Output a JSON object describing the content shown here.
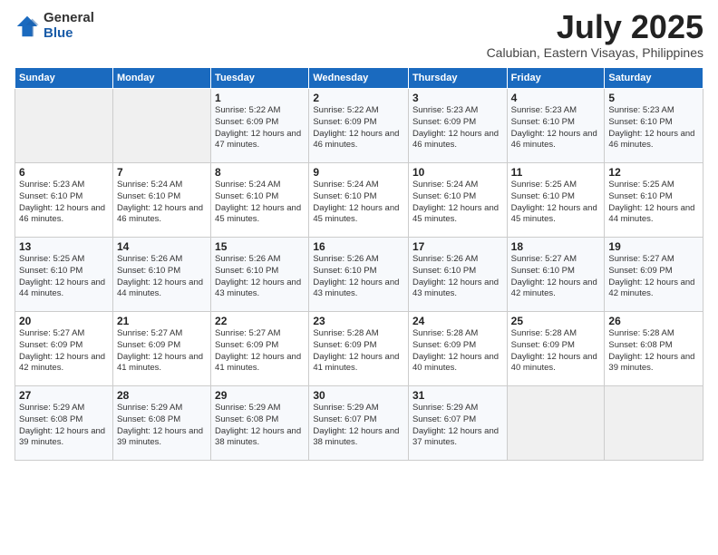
{
  "header": {
    "logo_line1": "General",
    "logo_line2": "Blue",
    "main_title": "July 2025",
    "subtitle": "Calubian, Eastern Visayas, Philippines"
  },
  "days_of_week": [
    "Sunday",
    "Monday",
    "Tuesday",
    "Wednesday",
    "Thursday",
    "Friday",
    "Saturday"
  ],
  "weeks": [
    [
      {
        "day": "",
        "info": ""
      },
      {
        "day": "",
        "info": ""
      },
      {
        "day": "1",
        "info": "Sunrise: 5:22 AM\nSunset: 6:09 PM\nDaylight: 12 hours and 47 minutes."
      },
      {
        "day": "2",
        "info": "Sunrise: 5:22 AM\nSunset: 6:09 PM\nDaylight: 12 hours and 46 minutes."
      },
      {
        "day": "3",
        "info": "Sunrise: 5:23 AM\nSunset: 6:09 PM\nDaylight: 12 hours and 46 minutes."
      },
      {
        "day": "4",
        "info": "Sunrise: 5:23 AM\nSunset: 6:10 PM\nDaylight: 12 hours and 46 minutes."
      },
      {
        "day": "5",
        "info": "Sunrise: 5:23 AM\nSunset: 6:10 PM\nDaylight: 12 hours and 46 minutes."
      }
    ],
    [
      {
        "day": "6",
        "info": "Sunrise: 5:23 AM\nSunset: 6:10 PM\nDaylight: 12 hours and 46 minutes."
      },
      {
        "day": "7",
        "info": "Sunrise: 5:24 AM\nSunset: 6:10 PM\nDaylight: 12 hours and 46 minutes."
      },
      {
        "day": "8",
        "info": "Sunrise: 5:24 AM\nSunset: 6:10 PM\nDaylight: 12 hours and 45 minutes."
      },
      {
        "day": "9",
        "info": "Sunrise: 5:24 AM\nSunset: 6:10 PM\nDaylight: 12 hours and 45 minutes."
      },
      {
        "day": "10",
        "info": "Sunrise: 5:24 AM\nSunset: 6:10 PM\nDaylight: 12 hours and 45 minutes."
      },
      {
        "day": "11",
        "info": "Sunrise: 5:25 AM\nSunset: 6:10 PM\nDaylight: 12 hours and 45 minutes."
      },
      {
        "day": "12",
        "info": "Sunrise: 5:25 AM\nSunset: 6:10 PM\nDaylight: 12 hours and 44 minutes."
      }
    ],
    [
      {
        "day": "13",
        "info": "Sunrise: 5:25 AM\nSunset: 6:10 PM\nDaylight: 12 hours and 44 minutes."
      },
      {
        "day": "14",
        "info": "Sunrise: 5:26 AM\nSunset: 6:10 PM\nDaylight: 12 hours and 44 minutes."
      },
      {
        "day": "15",
        "info": "Sunrise: 5:26 AM\nSunset: 6:10 PM\nDaylight: 12 hours and 43 minutes."
      },
      {
        "day": "16",
        "info": "Sunrise: 5:26 AM\nSunset: 6:10 PM\nDaylight: 12 hours and 43 minutes."
      },
      {
        "day": "17",
        "info": "Sunrise: 5:26 AM\nSunset: 6:10 PM\nDaylight: 12 hours and 43 minutes."
      },
      {
        "day": "18",
        "info": "Sunrise: 5:27 AM\nSunset: 6:10 PM\nDaylight: 12 hours and 42 minutes."
      },
      {
        "day": "19",
        "info": "Sunrise: 5:27 AM\nSunset: 6:09 PM\nDaylight: 12 hours and 42 minutes."
      }
    ],
    [
      {
        "day": "20",
        "info": "Sunrise: 5:27 AM\nSunset: 6:09 PM\nDaylight: 12 hours and 42 minutes."
      },
      {
        "day": "21",
        "info": "Sunrise: 5:27 AM\nSunset: 6:09 PM\nDaylight: 12 hours and 41 minutes."
      },
      {
        "day": "22",
        "info": "Sunrise: 5:27 AM\nSunset: 6:09 PM\nDaylight: 12 hours and 41 minutes."
      },
      {
        "day": "23",
        "info": "Sunrise: 5:28 AM\nSunset: 6:09 PM\nDaylight: 12 hours and 41 minutes."
      },
      {
        "day": "24",
        "info": "Sunrise: 5:28 AM\nSunset: 6:09 PM\nDaylight: 12 hours and 40 minutes."
      },
      {
        "day": "25",
        "info": "Sunrise: 5:28 AM\nSunset: 6:09 PM\nDaylight: 12 hours and 40 minutes."
      },
      {
        "day": "26",
        "info": "Sunrise: 5:28 AM\nSunset: 6:08 PM\nDaylight: 12 hours and 39 minutes."
      }
    ],
    [
      {
        "day": "27",
        "info": "Sunrise: 5:29 AM\nSunset: 6:08 PM\nDaylight: 12 hours and 39 minutes."
      },
      {
        "day": "28",
        "info": "Sunrise: 5:29 AM\nSunset: 6:08 PM\nDaylight: 12 hours and 39 minutes."
      },
      {
        "day": "29",
        "info": "Sunrise: 5:29 AM\nSunset: 6:08 PM\nDaylight: 12 hours and 38 minutes."
      },
      {
        "day": "30",
        "info": "Sunrise: 5:29 AM\nSunset: 6:07 PM\nDaylight: 12 hours and 38 minutes."
      },
      {
        "day": "31",
        "info": "Sunrise: 5:29 AM\nSunset: 6:07 PM\nDaylight: 12 hours and 37 minutes."
      },
      {
        "day": "",
        "info": ""
      },
      {
        "day": "",
        "info": ""
      }
    ]
  ]
}
